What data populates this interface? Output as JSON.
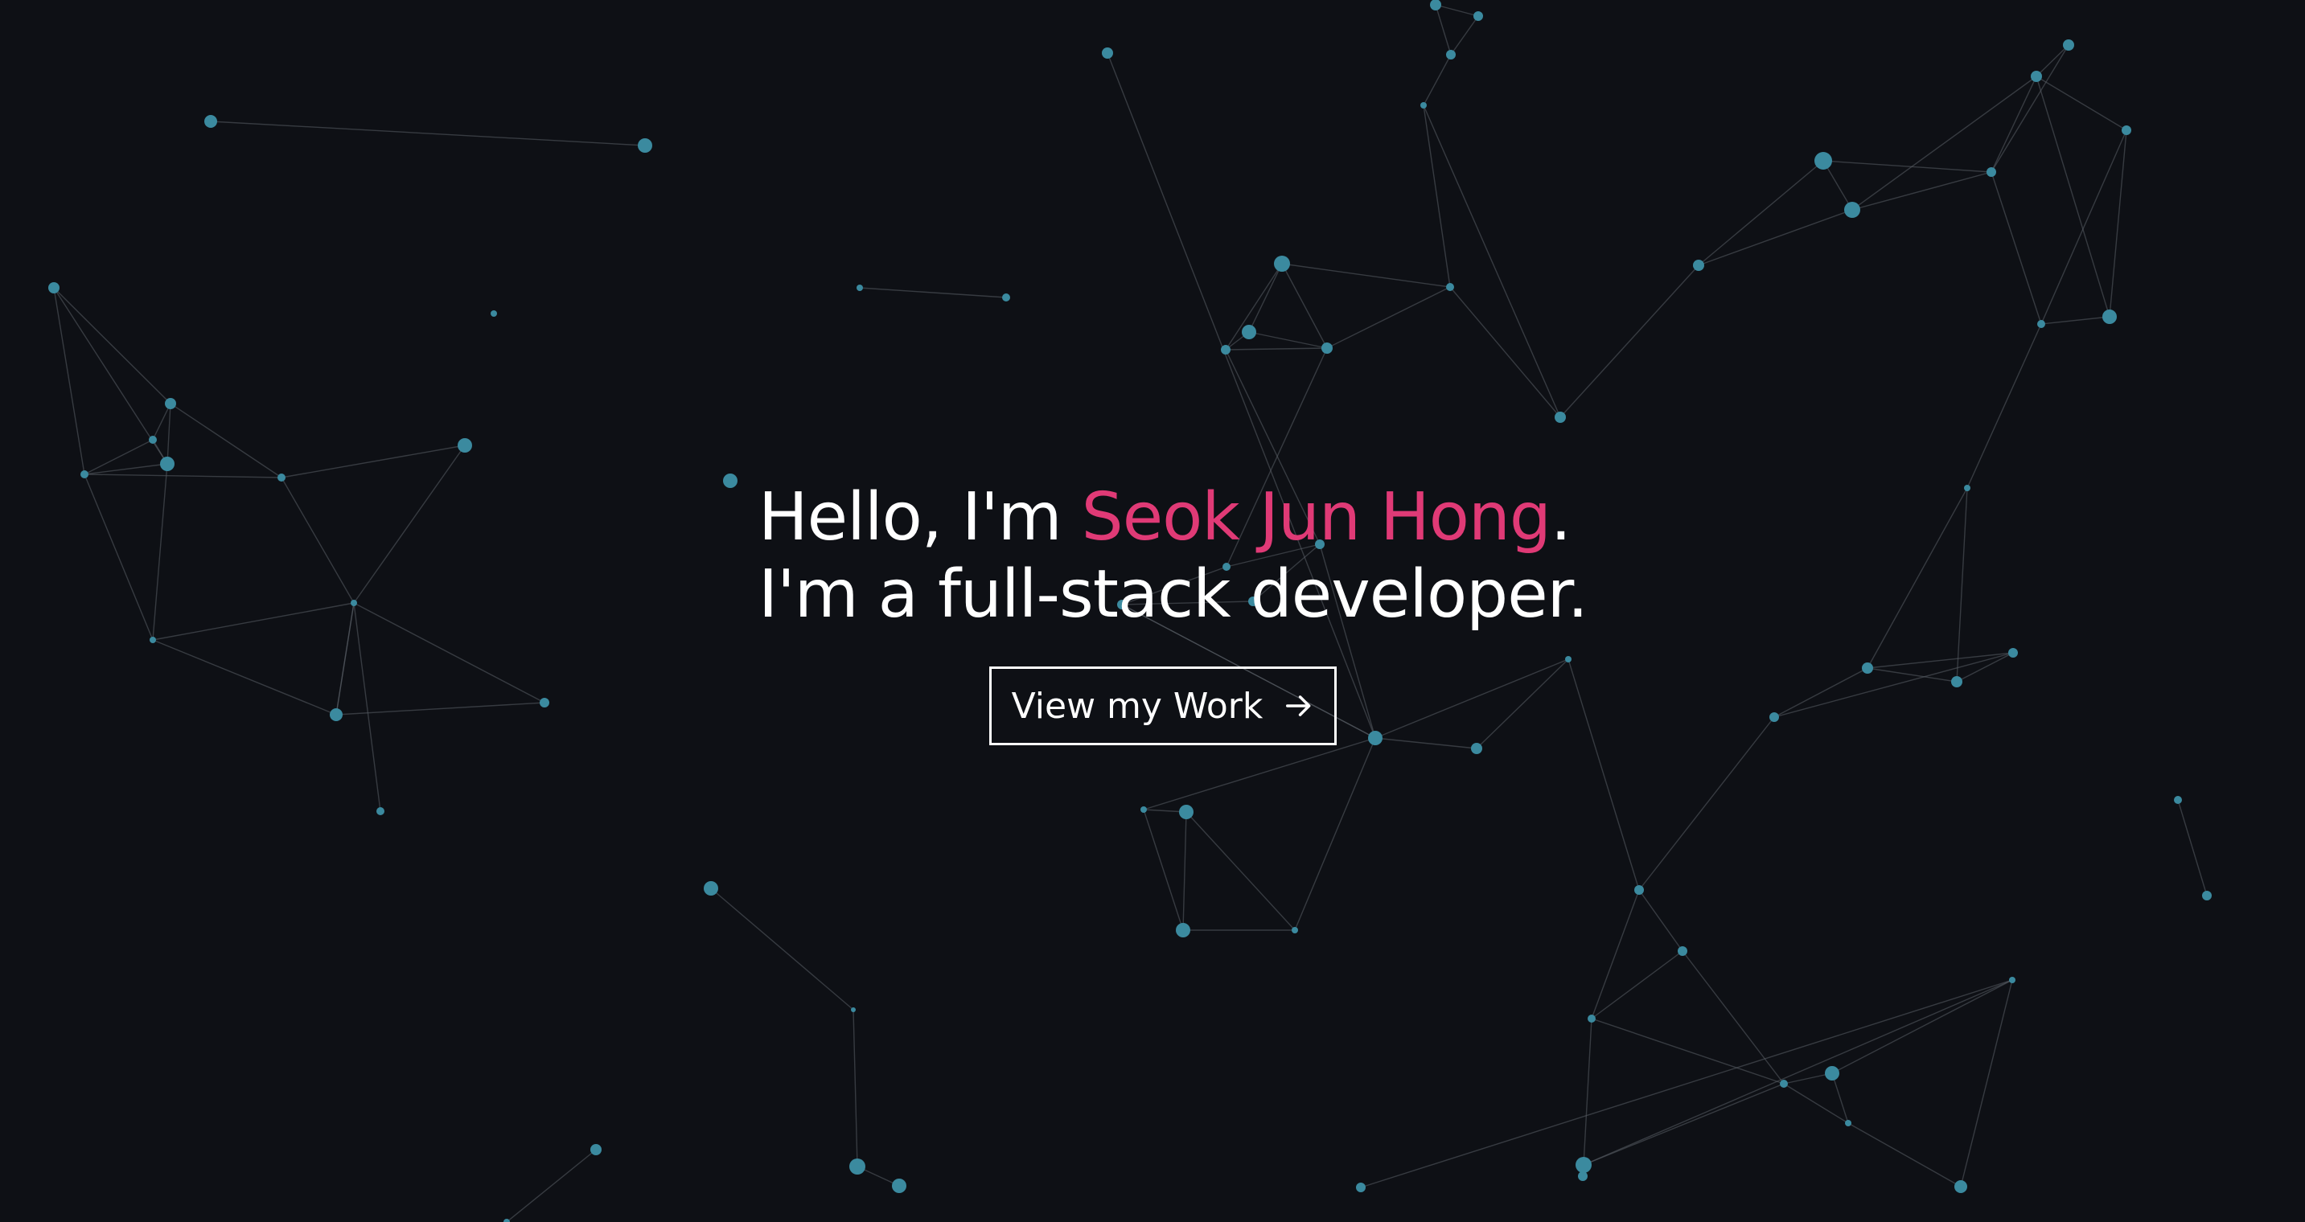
{
  "hero": {
    "greeting_prefix": "Hello, I'm ",
    "name": "Seok Jun Hong",
    "greeting_suffix": ".",
    "tagline": "I'm a full-stack developer.",
    "cta_label": "View my Work",
    "cta_icon": "arrow-right-icon"
  },
  "colors": {
    "background": "#0e1015",
    "accent": "#e03a76",
    "node": "#3b8a9f",
    "link": "#5a5f66",
    "text": "#ffffff"
  }
}
